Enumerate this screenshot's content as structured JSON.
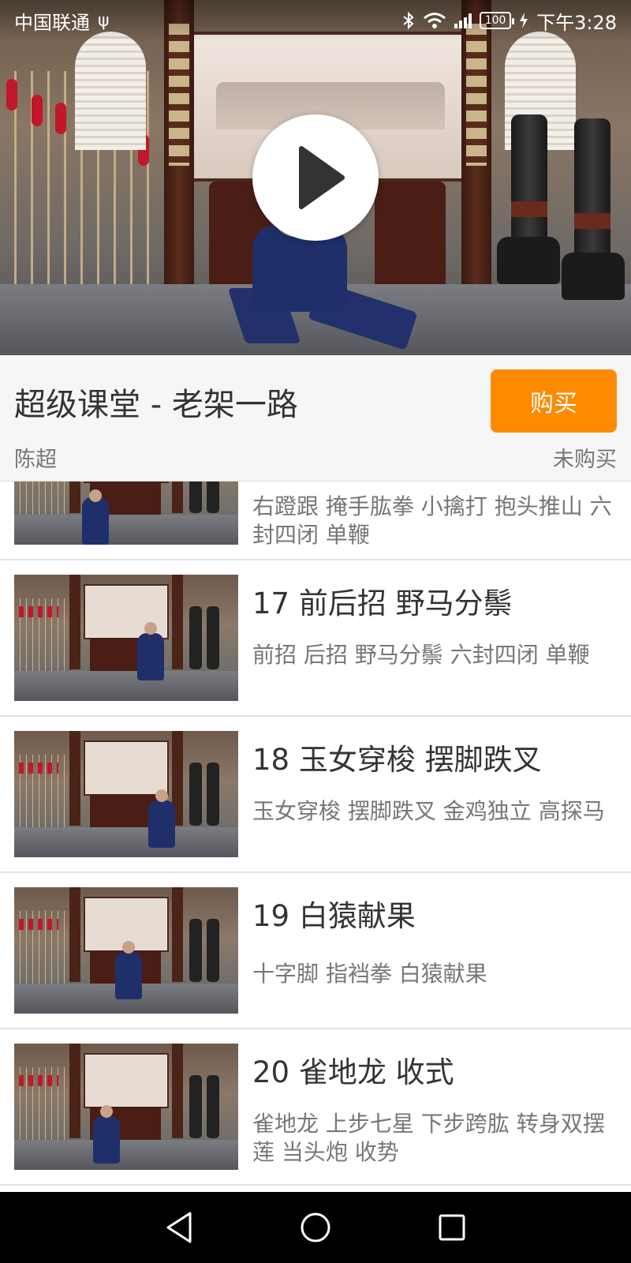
{
  "status_bar": {
    "carrier": "中国联通",
    "usb_symbol": "ψ",
    "battery": "100",
    "time": "下午3:28"
  },
  "video": {
    "play_icon": "play-icon"
  },
  "course": {
    "title": "超级课堂 - 老架一路",
    "buy_label": "购买",
    "teacher": "陈超",
    "purchase_status": "未购买",
    "accent_color": "#ff8a00"
  },
  "lessons": [
    {
      "title": "",
      "desc": "右蹬跟 掩手肱拳 小擒打 抱头推山 六封四闭 单鞭"
    },
    {
      "title": "17 前后招 野马分鬃",
      "desc": "前招 后招 野马分鬃 六封四闭 单鞭"
    },
    {
      "title": "18 玉女穿梭 摆脚跌叉",
      "desc": "玉女穿梭 摆脚跌叉 金鸡独立 高探马"
    },
    {
      "title": "19 白猿献果",
      "desc": "十字脚 指裆拳 白猿献果"
    },
    {
      "title": "20 雀地龙 收式",
      "desc": "雀地龙 上步七星 下步跨肱 转身双摆莲 当头炮 收势"
    }
  ],
  "nav": {
    "back_icon": "back-triangle-icon",
    "home_icon": "home-circle-icon",
    "recents_icon": "recents-square-icon"
  }
}
